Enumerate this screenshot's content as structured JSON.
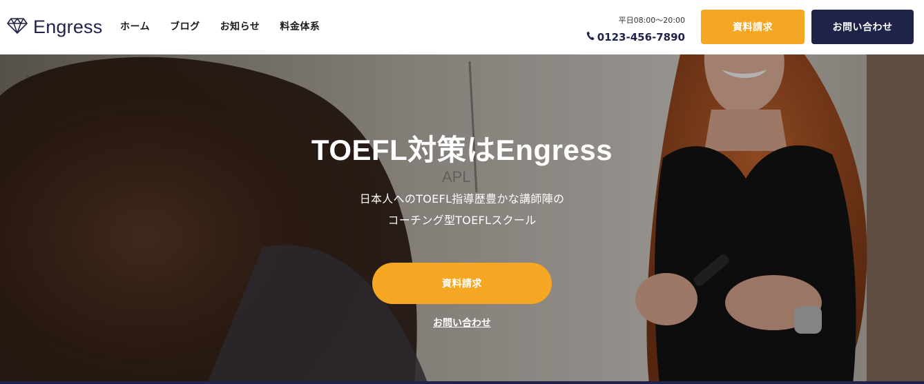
{
  "header": {
    "brand": "Engress",
    "nav": [
      "ホーム",
      "ブログ",
      "お知らせ",
      "料金体系"
    ],
    "hours": "平日08:00〜20:00",
    "phone": "0123-456-7890",
    "doc_button": "資料請求",
    "contact_button": "お問い合わせ"
  },
  "hero": {
    "title": "TOEFL対策はEngress",
    "subtitle_line1": "日本人へのTOEFL指導歴豊かな講師陣の",
    "subtitle_line2": "コーチング型TOEFLスクール",
    "cta_button": "資料請求",
    "contact_link": "お問い合わせ"
  },
  "colors": {
    "accent_orange": "#f5a623",
    "navy": "#1f2347",
    "white": "#ffffff"
  },
  "icons": {
    "logo": "diamond-icon",
    "phone": "phone-icon"
  }
}
